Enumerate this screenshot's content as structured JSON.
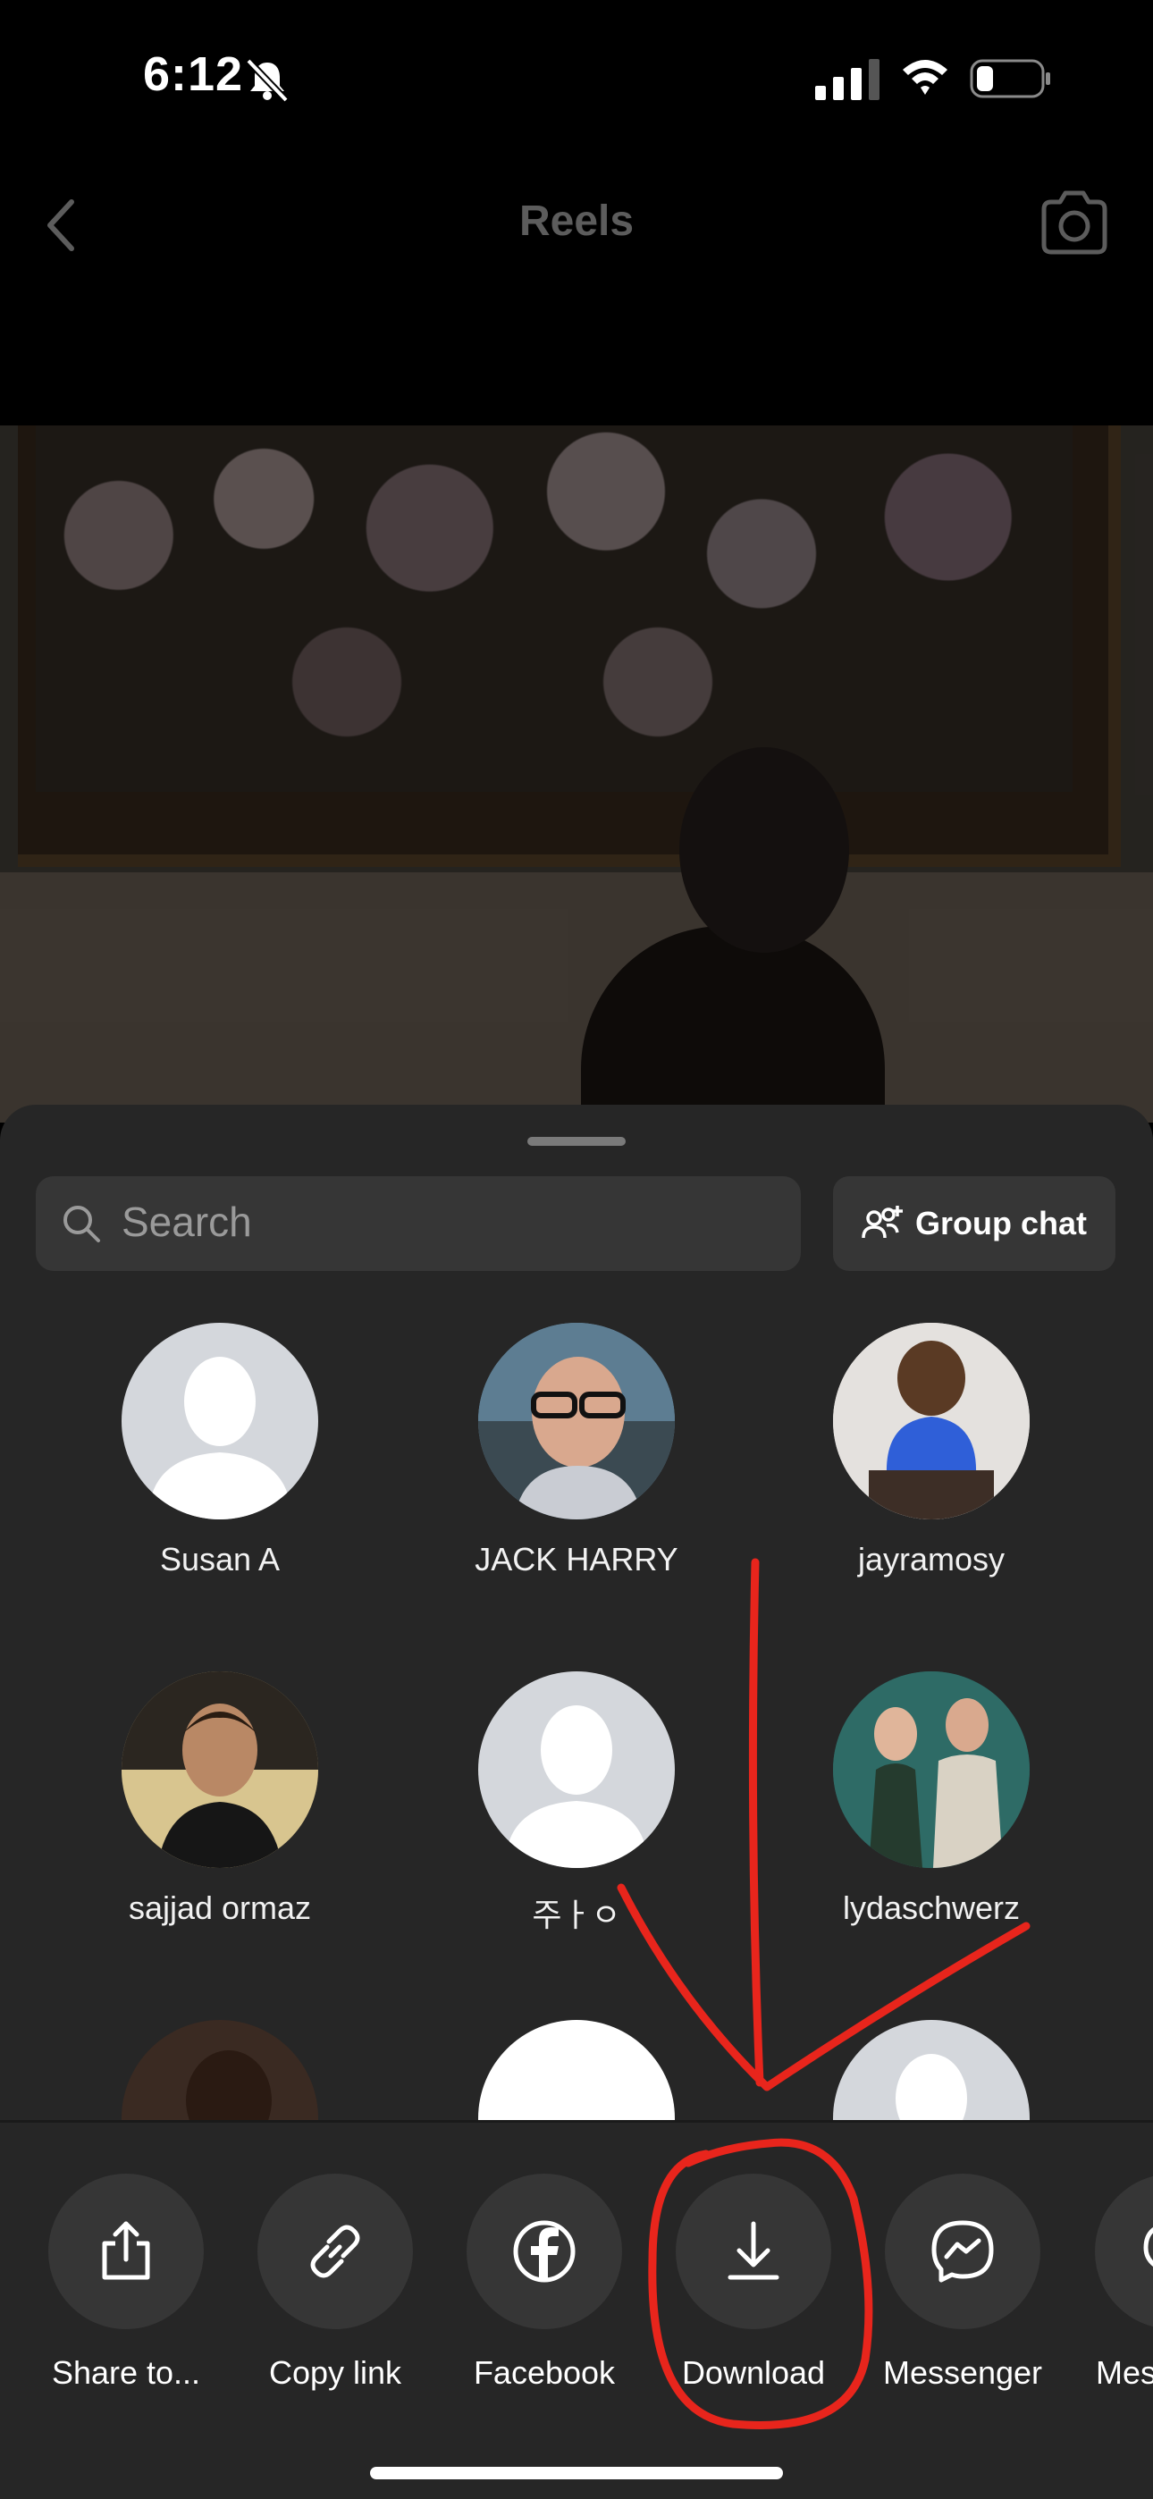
{
  "status_bar": {
    "time": "6:12"
  },
  "nav": {
    "title": "Reels"
  },
  "share_sheet": {
    "search_placeholder": "Search",
    "group_chat_label": "Group chat",
    "contacts": [
      {
        "name": "Susan A",
        "avatar": "default"
      },
      {
        "name": "JACK HARRY",
        "avatar": "photo"
      },
      {
        "name": "jayramosy",
        "avatar": "photo"
      },
      {
        "name": "sajjad ormaz",
        "avatar": "photo"
      },
      {
        "name": "주ㅏㅇ",
        "avatar": "default"
      },
      {
        "name": "lydaschwerz",
        "avatar": "photo"
      }
    ]
  },
  "actions": [
    {
      "label": "Share to...",
      "icon": "share-icon"
    },
    {
      "label": "Copy link",
      "icon": "link-icon"
    },
    {
      "label": "Facebook",
      "icon": "facebook-icon"
    },
    {
      "label": "Download",
      "icon": "download-icon"
    },
    {
      "label": "Messenger",
      "icon": "messenger-icon"
    },
    {
      "label": "Mes",
      "icon": "message-icon"
    }
  ],
  "annotation_color": "#e8251c"
}
